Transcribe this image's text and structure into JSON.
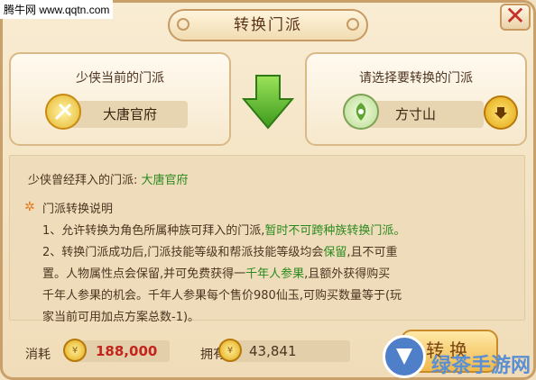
{
  "watermark": {
    "site": "腾牛网 www.qqtn.com",
    "corner_logo": "绿茶手游网"
  },
  "title": "转换门派",
  "current": {
    "caption": "少侠当前的门派",
    "school": "大唐官府"
  },
  "target": {
    "caption": "请选择要转换的门派",
    "school": "方寸山"
  },
  "info": {
    "former_label": "少侠曾经拜入的门派: ",
    "former_value": "大唐官府",
    "desc_title": "门派转换说明",
    "line1_a": "1、允许转换为角色所属种族可拜入的门派,",
    "line1_b": "暂时不可跨种族转换门派。",
    "line2_a": "2、转换门派成功后,门派技能等级和帮派技能等级均会",
    "line2_b": "保留",
    "line2_c": ",且不可重",
    "line3_a": "置。人物属性点会保留,并可免费获得一",
    "line3_b": "千年人参果",
    "line3_c": ",且额外获得购买",
    "line4": "千年人参果的机会。千年人参果每个售价980仙玉,可购买数量等于(玩",
    "line5": "家当前可用加点方案总数-1)。"
  },
  "cost": {
    "label": "消耗",
    "value": "188,000"
  },
  "own": {
    "label": "拥有",
    "value": "43,841"
  },
  "switch_button": "转换",
  "colors": {
    "accent_green": "#2b8a1e",
    "cost_red": "#c4241c",
    "close_red": "#c5302a"
  }
}
